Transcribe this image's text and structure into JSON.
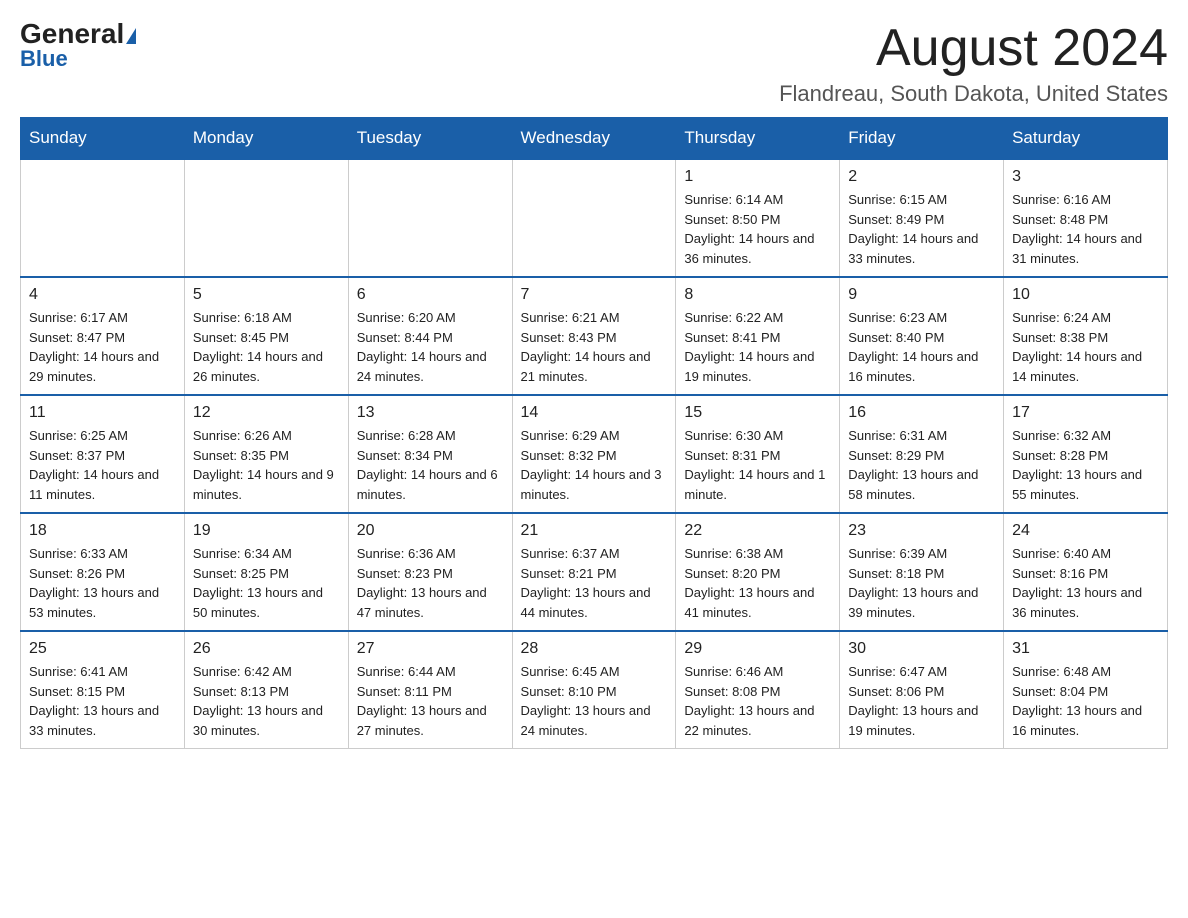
{
  "logo": {
    "text_general": "General",
    "triangle_label": "logo-triangle",
    "text_blue": "Blue"
  },
  "header": {
    "month_title": "August 2024",
    "location": "Flandreau, South Dakota, United States"
  },
  "weekdays": [
    "Sunday",
    "Monday",
    "Tuesday",
    "Wednesday",
    "Thursday",
    "Friday",
    "Saturday"
  ],
  "weeks": [
    [
      {
        "day": "",
        "info": ""
      },
      {
        "day": "",
        "info": ""
      },
      {
        "day": "",
        "info": ""
      },
      {
        "day": "",
        "info": ""
      },
      {
        "day": "1",
        "info": "Sunrise: 6:14 AM\nSunset: 8:50 PM\nDaylight: 14 hours and 36 minutes."
      },
      {
        "day": "2",
        "info": "Sunrise: 6:15 AM\nSunset: 8:49 PM\nDaylight: 14 hours and 33 minutes."
      },
      {
        "day": "3",
        "info": "Sunrise: 6:16 AM\nSunset: 8:48 PM\nDaylight: 14 hours and 31 minutes."
      }
    ],
    [
      {
        "day": "4",
        "info": "Sunrise: 6:17 AM\nSunset: 8:47 PM\nDaylight: 14 hours and 29 minutes."
      },
      {
        "day": "5",
        "info": "Sunrise: 6:18 AM\nSunset: 8:45 PM\nDaylight: 14 hours and 26 minutes."
      },
      {
        "day": "6",
        "info": "Sunrise: 6:20 AM\nSunset: 8:44 PM\nDaylight: 14 hours and 24 minutes."
      },
      {
        "day": "7",
        "info": "Sunrise: 6:21 AM\nSunset: 8:43 PM\nDaylight: 14 hours and 21 minutes."
      },
      {
        "day": "8",
        "info": "Sunrise: 6:22 AM\nSunset: 8:41 PM\nDaylight: 14 hours and 19 minutes."
      },
      {
        "day": "9",
        "info": "Sunrise: 6:23 AM\nSunset: 8:40 PM\nDaylight: 14 hours and 16 minutes."
      },
      {
        "day": "10",
        "info": "Sunrise: 6:24 AM\nSunset: 8:38 PM\nDaylight: 14 hours and 14 minutes."
      }
    ],
    [
      {
        "day": "11",
        "info": "Sunrise: 6:25 AM\nSunset: 8:37 PM\nDaylight: 14 hours and 11 minutes."
      },
      {
        "day": "12",
        "info": "Sunrise: 6:26 AM\nSunset: 8:35 PM\nDaylight: 14 hours and 9 minutes."
      },
      {
        "day": "13",
        "info": "Sunrise: 6:28 AM\nSunset: 8:34 PM\nDaylight: 14 hours and 6 minutes."
      },
      {
        "day": "14",
        "info": "Sunrise: 6:29 AM\nSunset: 8:32 PM\nDaylight: 14 hours and 3 minutes."
      },
      {
        "day": "15",
        "info": "Sunrise: 6:30 AM\nSunset: 8:31 PM\nDaylight: 14 hours and 1 minute."
      },
      {
        "day": "16",
        "info": "Sunrise: 6:31 AM\nSunset: 8:29 PM\nDaylight: 13 hours and 58 minutes."
      },
      {
        "day": "17",
        "info": "Sunrise: 6:32 AM\nSunset: 8:28 PM\nDaylight: 13 hours and 55 minutes."
      }
    ],
    [
      {
        "day": "18",
        "info": "Sunrise: 6:33 AM\nSunset: 8:26 PM\nDaylight: 13 hours and 53 minutes."
      },
      {
        "day": "19",
        "info": "Sunrise: 6:34 AM\nSunset: 8:25 PM\nDaylight: 13 hours and 50 minutes."
      },
      {
        "day": "20",
        "info": "Sunrise: 6:36 AM\nSunset: 8:23 PM\nDaylight: 13 hours and 47 minutes."
      },
      {
        "day": "21",
        "info": "Sunrise: 6:37 AM\nSunset: 8:21 PM\nDaylight: 13 hours and 44 minutes."
      },
      {
        "day": "22",
        "info": "Sunrise: 6:38 AM\nSunset: 8:20 PM\nDaylight: 13 hours and 41 minutes."
      },
      {
        "day": "23",
        "info": "Sunrise: 6:39 AM\nSunset: 8:18 PM\nDaylight: 13 hours and 39 minutes."
      },
      {
        "day": "24",
        "info": "Sunrise: 6:40 AM\nSunset: 8:16 PM\nDaylight: 13 hours and 36 minutes."
      }
    ],
    [
      {
        "day": "25",
        "info": "Sunrise: 6:41 AM\nSunset: 8:15 PM\nDaylight: 13 hours and 33 minutes."
      },
      {
        "day": "26",
        "info": "Sunrise: 6:42 AM\nSunset: 8:13 PM\nDaylight: 13 hours and 30 minutes."
      },
      {
        "day": "27",
        "info": "Sunrise: 6:44 AM\nSunset: 8:11 PM\nDaylight: 13 hours and 27 minutes."
      },
      {
        "day": "28",
        "info": "Sunrise: 6:45 AM\nSunset: 8:10 PM\nDaylight: 13 hours and 24 minutes."
      },
      {
        "day": "29",
        "info": "Sunrise: 6:46 AM\nSunset: 8:08 PM\nDaylight: 13 hours and 22 minutes."
      },
      {
        "day": "30",
        "info": "Sunrise: 6:47 AM\nSunset: 8:06 PM\nDaylight: 13 hours and 19 minutes."
      },
      {
        "day": "31",
        "info": "Sunrise: 6:48 AM\nSunset: 8:04 PM\nDaylight: 13 hours and 16 minutes."
      }
    ]
  ]
}
